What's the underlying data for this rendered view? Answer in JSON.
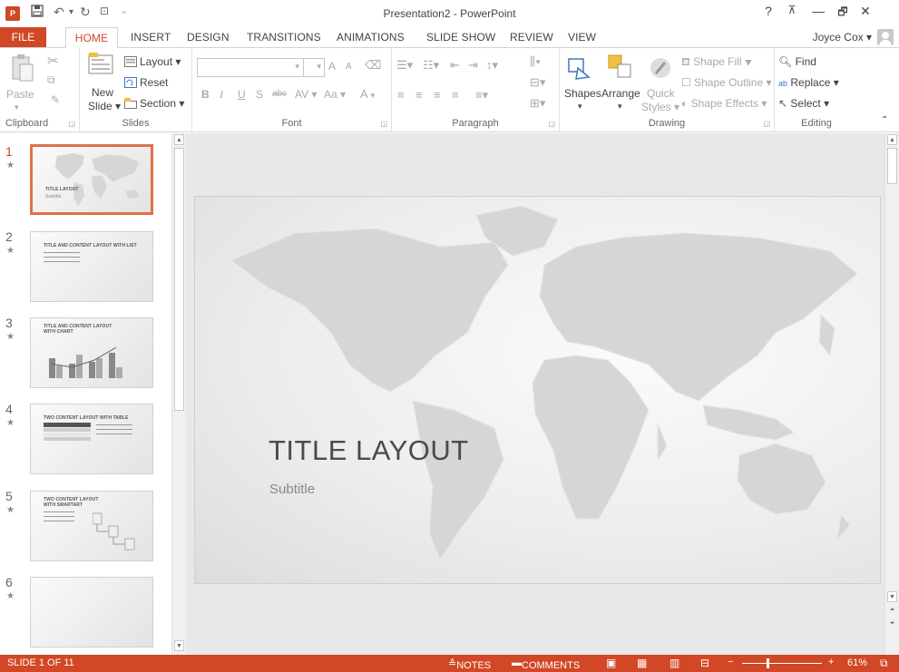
{
  "window": {
    "title": "Presentation2 - PowerPoint",
    "app_icon": "P"
  },
  "titlebar": {
    "help": "?",
    "restore_ribbon": "⊼",
    "minimize": "—",
    "maximize": "🗗",
    "close": "✕"
  },
  "tabs": [
    "FILE",
    "HOME",
    "INSERT",
    "DESIGN",
    "TRANSITIONS",
    "ANIMATIONS",
    "SLIDE SHOW",
    "REVIEW",
    "VIEW"
  ],
  "user": {
    "name": "Joyce Cox",
    "caret": "▾"
  },
  "ribbon": {
    "clipboard": {
      "label": "Clipboard",
      "paste": "Paste"
    },
    "slides": {
      "label": "Slides",
      "new_slide_1": "New",
      "new_slide_2": "Slide",
      "layout": "Layout",
      "reset": "Reset",
      "section": "Section"
    },
    "font": {
      "label": "Font",
      "grow": "A",
      "shrink": "A",
      "bold": "B",
      "italic": "I",
      "underline": "U",
      "shadow": "S",
      "strike": "abc",
      "spacing": "AV",
      "case": "Aa",
      "color": "A"
    },
    "paragraph": {
      "label": "Paragraph"
    },
    "drawing": {
      "label": "Drawing",
      "shapes": "Shapes",
      "arrange": "Arrange",
      "quick_styles_1": "Quick",
      "quick_styles_2": "Styles",
      "shape_fill": "Shape Fill",
      "shape_outline": "Shape Outline",
      "shape_effects": "Shape Effects"
    },
    "editing": {
      "label": "Editing",
      "find": "Find",
      "replace": "Replace",
      "select": "Select"
    }
  },
  "thumbnails": [
    {
      "num": "1",
      "title": "TITLE LAYOUT",
      "sub": "Subtitle"
    },
    {
      "num": "2",
      "title": "TITLE AND CONTENT LAYOUT WITH LIST"
    },
    {
      "num": "3",
      "title": "TITLE AND CONTENT LAYOUT",
      "title2": "WITH CHART"
    },
    {
      "num": "4",
      "title": "TWO CONTENT LAYOUT WITH TABLE"
    },
    {
      "num": "5",
      "title": "TWO CONTENT LAYOUT",
      "title2": "WITH SMARTART"
    },
    {
      "num": "6",
      "title": ""
    }
  ],
  "slide": {
    "title": "TITLE LAYOUT",
    "subtitle": "Subtitle"
  },
  "status": {
    "slide": "SLIDE 1 OF 11",
    "notes": "NOTES",
    "comments": "COMMENTS",
    "zoom": "61%"
  }
}
